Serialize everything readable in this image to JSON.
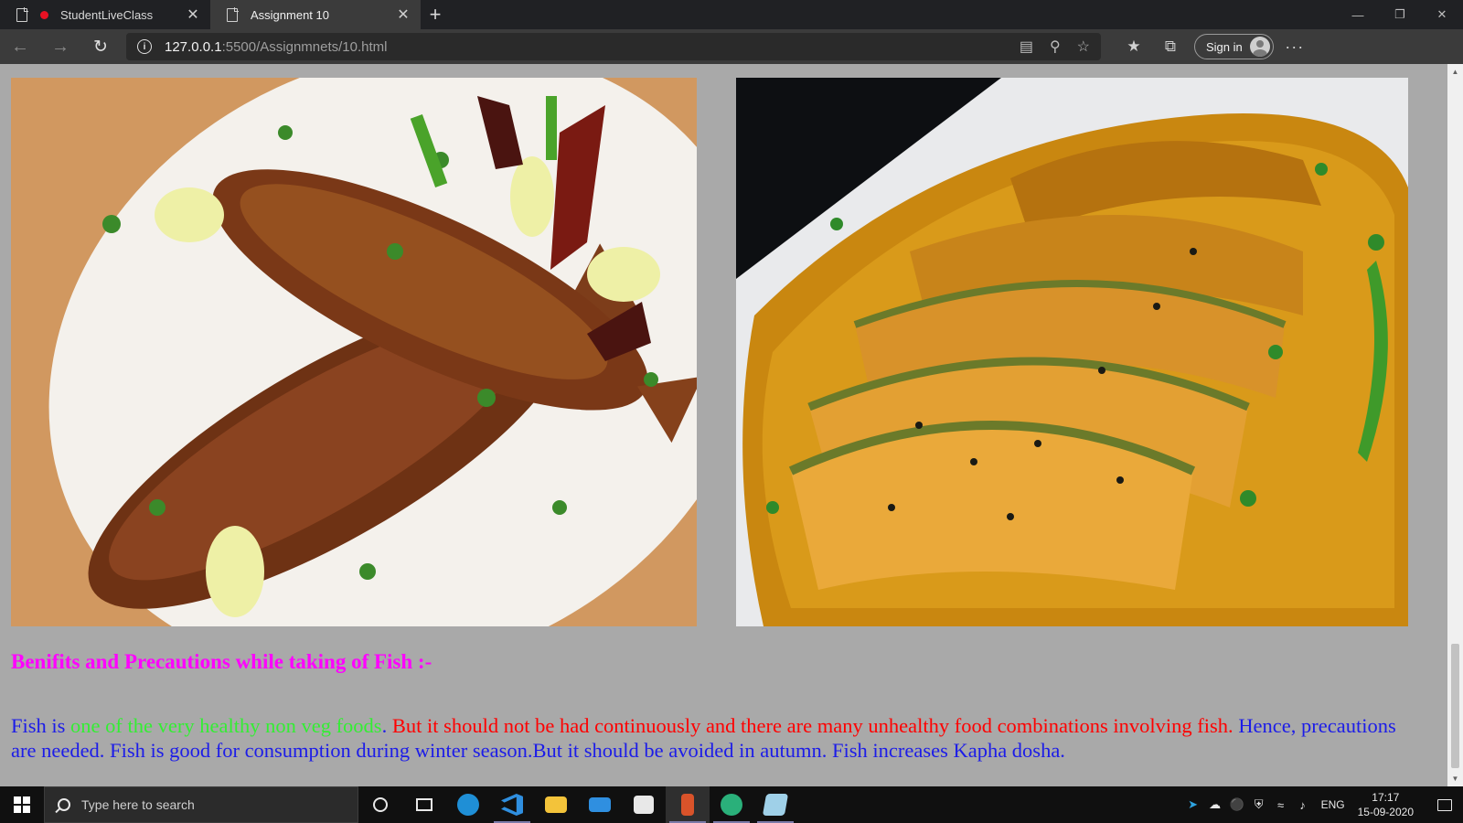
{
  "browser": {
    "tabs": [
      {
        "label": "StudentLiveClass",
        "close": "✕"
      },
      {
        "label": "Assignment 10",
        "close": "✕"
      }
    ],
    "new_tab": "+",
    "url": {
      "host": "127.0.0.1",
      "rest": ":5500/Assignmnets/10.html"
    },
    "signin_label": "Sign in",
    "more_label": "···"
  },
  "page": {
    "images": [
      {
        "name": "grilled-fish-photo"
      },
      {
        "name": "fish-curry-photo"
      }
    ],
    "heading": "Benifits and Precautions while taking of Fish :-",
    "paragraph": {
      "part1": "Fish is ",
      "part2_green": "one of the very healthy non veg foods",
      "part3": ". ",
      "part4_red": "But it should not be had continuously and there are many unhealthy food combinations involving fish.",
      "part5": " Hence, precautions are needed. Fish is good for consumption during winter season.But it should be avoided in autumn. Fish increases Kapha dosha."
    },
    "colors": {
      "background": "#a9a9a9",
      "heading": "#ff00ff",
      "text": "#1c1ce8",
      "green": "#33ee33",
      "red": "#ff0000"
    }
  },
  "taskbar": {
    "search_placeholder": "Type here to search",
    "apps": [
      "cortana-icon",
      "task-view-icon",
      "edge-icon",
      "vscode-icon",
      "file-explorer-icon",
      "mail-icon",
      "store-icon",
      "app-icon",
      "edge-dev-icon",
      "notepad-icon"
    ],
    "language": "ENG",
    "time": "17:17",
    "date": "15-09-2020"
  }
}
